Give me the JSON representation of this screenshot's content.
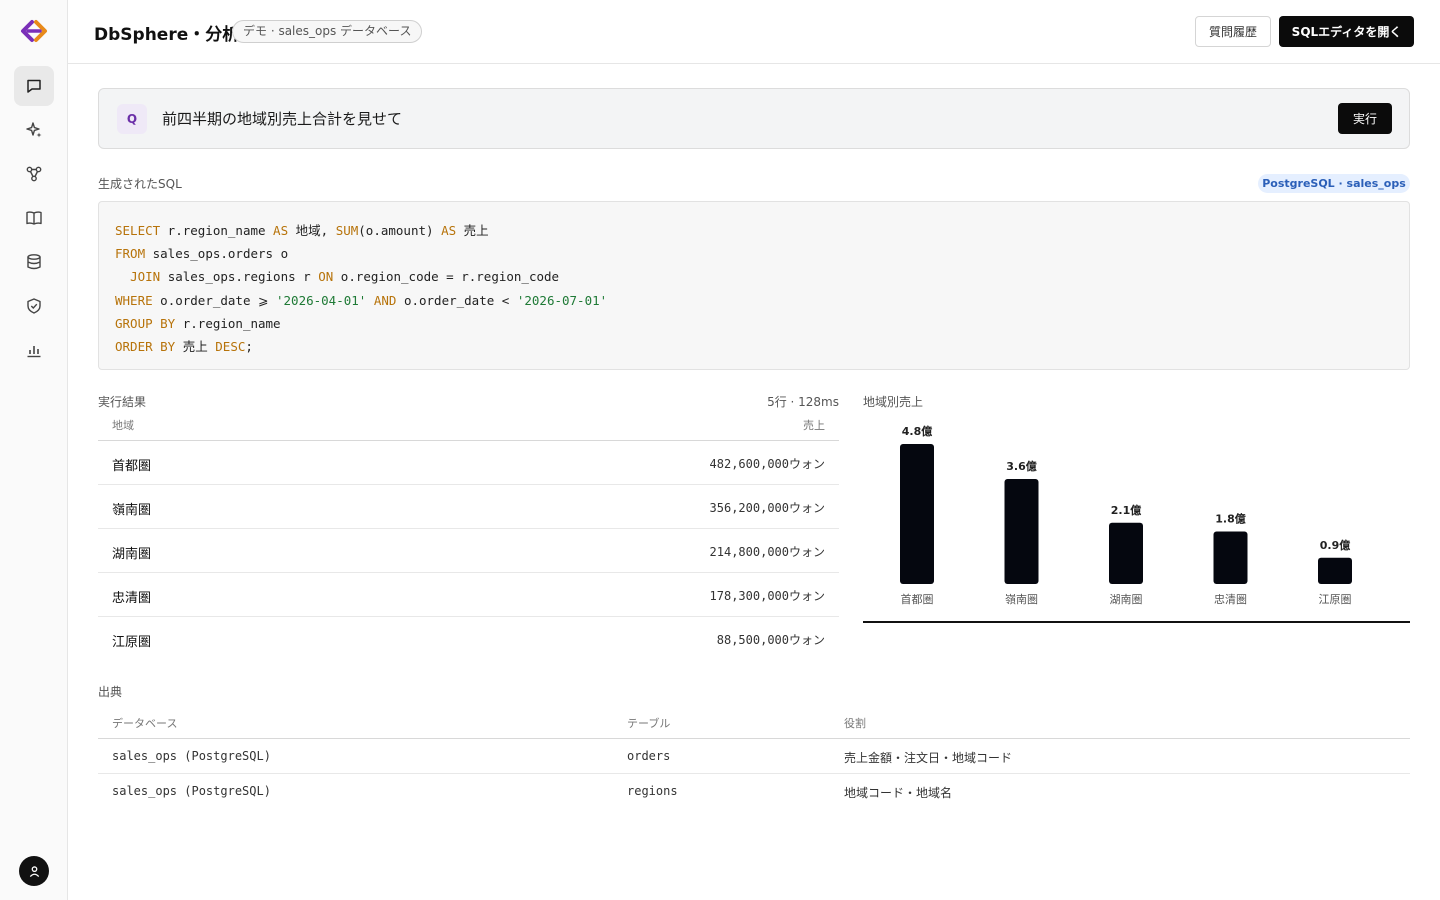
{
  "sidebar": {
    "logo": "dbsphere-logo",
    "items": [
      {
        "name": "chat-icon",
        "active": true
      },
      {
        "name": "sparkle-icon",
        "active": false
      },
      {
        "name": "schema-icon",
        "active": false
      },
      {
        "name": "book-icon",
        "active": false
      },
      {
        "name": "database-icon",
        "active": false
      },
      {
        "name": "shield-icon",
        "active": false
      },
      {
        "name": "chart-icon",
        "active": false
      }
    ],
    "user_icon": "user-icon"
  },
  "header": {
    "title": "DbSphere・分析",
    "db_badge": "デモ · sales_ops データベース",
    "history_button": "質問履歴",
    "sql_editor_button": "SQLエディタを開く"
  },
  "query": {
    "badge": "Q",
    "text": "前四半期の地域別売上合計を見せて",
    "run_button": "実行"
  },
  "sql": {
    "label": "生成されたSQL",
    "engine_badge": "PostgreSQL · sales_ops",
    "lines": [
      [
        {
          "t": "SELECT",
          "k": "kw"
        },
        {
          "t": " r.region_name "
        },
        {
          "t": "AS",
          "k": "kw"
        },
        {
          "t": " 地域, "
        },
        {
          "t": "SUM",
          "k": "kw"
        },
        {
          "t": "(o.amount) "
        },
        {
          "t": "AS",
          "k": "kw"
        },
        {
          "t": " 売上"
        }
      ],
      [
        {
          "t": "FROM",
          "k": "kw"
        },
        {
          "t": " sales_ops.orders o"
        }
      ],
      [
        {
          "t": "  "
        },
        {
          "t": "JOIN",
          "k": "kw"
        },
        {
          "t": " sales_ops.regions r "
        },
        {
          "t": "ON",
          "k": "kw"
        },
        {
          "t": " o.region_code = r.region_code"
        }
      ],
      [
        {
          "t": "WHERE",
          "k": "kw"
        },
        {
          "t": " o.order_date ⩾ "
        },
        {
          "t": "'2026-04-01'",
          "k": "str"
        },
        {
          "t": " "
        },
        {
          "t": "AND",
          "k": "kw"
        },
        {
          "t": " o.order_date < "
        },
        {
          "t": "'2026-07-01'",
          "k": "str"
        }
      ],
      [
        {
          "t": "GROUP BY",
          "k": "kw"
        },
        {
          "t": " r.region_name"
        }
      ],
      [
        {
          "t": "ORDER BY",
          "k": "kw"
        },
        {
          "t": " 売上 "
        },
        {
          "t": "DESC",
          "k": "kw"
        },
        {
          "t": ";"
        }
      ]
    ]
  },
  "results": {
    "label": "実行結果",
    "meta": "5行 · 128ms",
    "columns": [
      "地域",
      "売上"
    ],
    "rows": [
      [
        "首都圏",
        "482,600,000ウォン"
      ],
      [
        "嶺南圏",
        "356,200,000ウォン"
      ],
      [
        "湖南圏",
        "214,800,000ウォン"
      ],
      [
        "忠清圏",
        "178,300,000ウォン"
      ],
      [
        "江原圏",
        "88,500,000ウォン"
      ]
    ]
  },
  "chart_data": {
    "type": "bar",
    "title": "地域別売上",
    "categories": [
      "首都圏",
      "嶺南圏",
      "湖南圏",
      "忠清圏",
      "江原圏"
    ],
    "values": [
      4.8,
      3.6,
      2.1,
      1.8,
      0.9
    ],
    "data_labels": [
      "4.8億",
      "3.6億",
      "2.1億",
      "1.8億",
      "0.9億"
    ],
    "xlabel": "",
    "ylabel": "",
    "ylim": [
      0,
      4.8
    ],
    "grid": false,
    "bar_color": "#05070f"
  },
  "sources": {
    "label": "出典",
    "columns": [
      "データベース",
      "テーブル",
      "役割"
    ],
    "rows": [
      [
        "sales_ops (PostgreSQL)",
        "orders",
        "売上金額・注文日・地域コード"
      ],
      [
        "sales_ops (PostgreSQL)",
        "regions",
        "地域コード・地域名"
      ]
    ]
  }
}
